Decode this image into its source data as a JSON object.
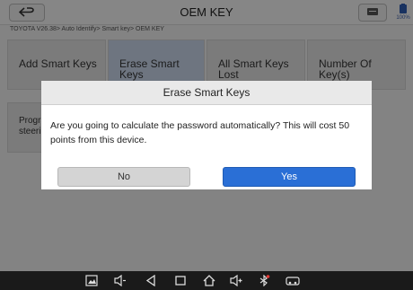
{
  "header": {
    "title": "OEM KEY",
    "battery_label": "100%"
  },
  "breadcrumb": "TOYOTA V26.38> Auto Identify> Smart key> OEM KEY",
  "tiles": [
    {
      "line1": "Add Smart Keys",
      "line2": ""
    },
    {
      "line1": "Erase Smart",
      "line2": "Keys"
    },
    {
      "line1": "All Smart Keys",
      "line2": "Lost"
    },
    {
      "line1": "Number Of",
      "line2": "Key(s)"
    },
    {
      "line1": "Progra",
      "line2": "steerin"
    }
  ],
  "dialog": {
    "title": "Erase Smart Keys",
    "message": "Are you going to calculate the password automatically? This will cost 50 points from this device.",
    "no_label": "No",
    "yes_label": "Yes"
  },
  "colors": {
    "accent": "#2a6fd6",
    "navbar": "#1a1a1a"
  },
  "nav_icons": [
    "screenshot-icon",
    "volume-down-icon",
    "back-triangle-icon",
    "home-icon",
    "recent-apps-icon",
    "volume-up-icon",
    "bluetooth-icon",
    "vci-car-icon"
  ]
}
